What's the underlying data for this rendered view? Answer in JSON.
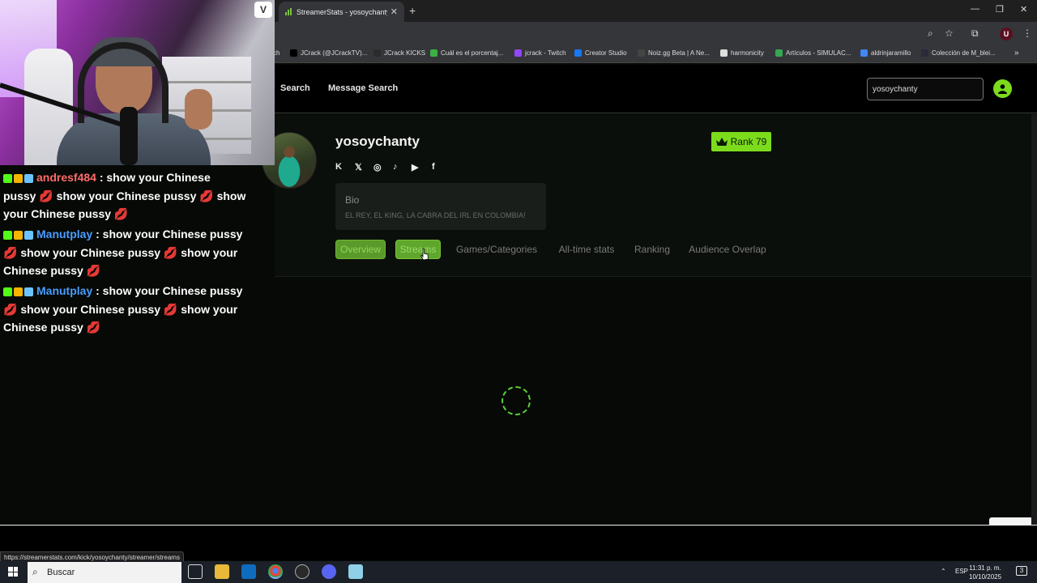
{
  "browser": {
    "tab_title": "StreamerStats - yosoychanty P...",
    "tab_close": "✕",
    "new_tab": "+",
    "window_controls": {
      "minimize": "—",
      "restore": "❐",
      "close": "✕"
    },
    "toolbar_icons": [
      "zoom-icon",
      "star-icon",
      "extensions-icon",
      "menu-icon"
    ],
    "profile_letter": "U",
    "bookmarks": [
      {
        "label": "ch",
        "color": "#35363a"
      },
      {
        "label": "JCrack (@JCrackTV)...",
        "color": "#000000"
      },
      {
        "label": "JCrack KICKS",
        "color": "#2b2b2b"
      },
      {
        "label": "Cuál es el porcentaj...",
        "color": "#3cb043"
      },
      {
        "label": "jcrack - Twitch",
        "color": "#9146ff"
      },
      {
        "label": "Creator Studio",
        "color": "#1877f2"
      },
      {
        "label": "Noiz.gg Beta | A Ne...",
        "color": "#444444"
      },
      {
        "label": "harmonicity",
        "color": "#dddddd"
      },
      {
        "label": "Artículos - SIMULAC...",
        "color": "#34a853"
      },
      {
        "label": "aldrinjaramillo",
        "color": "#4285f4"
      },
      {
        "label": "Colección de M_blei...",
        "color": "#2a2a3a"
      }
    ],
    "bookmarks_more": "»",
    "status_url": "https://streamerstats.com/kick/yosoychanty/streamer/streams"
  },
  "site": {
    "nav": {
      "search": "Search",
      "message_search": "Message Search"
    },
    "search_value": "yosoychanty",
    "accent": "#7cdc1c",
    "profile": {
      "username": "yosoychanty",
      "rank_label": "Rank 79",
      "socials": [
        "kick-icon",
        "x-icon",
        "instagram-icon",
        "tiktok-icon",
        "youtube-icon",
        "facebook-icon"
      ],
      "social_glyphs": {
        "kick": "K",
        "x": "𝕏",
        "instagram": "◎",
        "tiktok": "♪",
        "youtube": "▶",
        "facebook": "f"
      },
      "bio_title": "Bio",
      "bio_text": "EL REY, EL KING, LA CABRA DEL IRL EN COLOMBIA!"
    },
    "tabs": [
      "Overview",
      "Streams",
      "Games/Categories",
      "All-time stats",
      "Ranking",
      "Audience Overlap"
    ],
    "loading": true
  },
  "chat": [
    {
      "user": "andresf484",
      "user_color": "#ff6b6b",
      "text": ": show your Chinese pussy 💋 show your Chinese pussy 💋 show your Chinese pussy 💋"
    },
    {
      "user": "Manutplay",
      "user_color": "#4a9dff",
      "text": ": show your Chinese pussy 💋 show your Chinese pussy 💋 show your Chinese pussy 💋"
    },
    {
      "user": "Manutplay",
      "user_color": "#4a9dff",
      "text": ": show your Chinese pussy 💋 show your Chinese pussy 💋 show your Chinese pussy 💋"
    }
  ],
  "taskbar": {
    "search_label": "Buscar",
    "language": "ESP",
    "time": "11:31 p. m.",
    "date": "10/10/2025",
    "notifications": "3"
  }
}
